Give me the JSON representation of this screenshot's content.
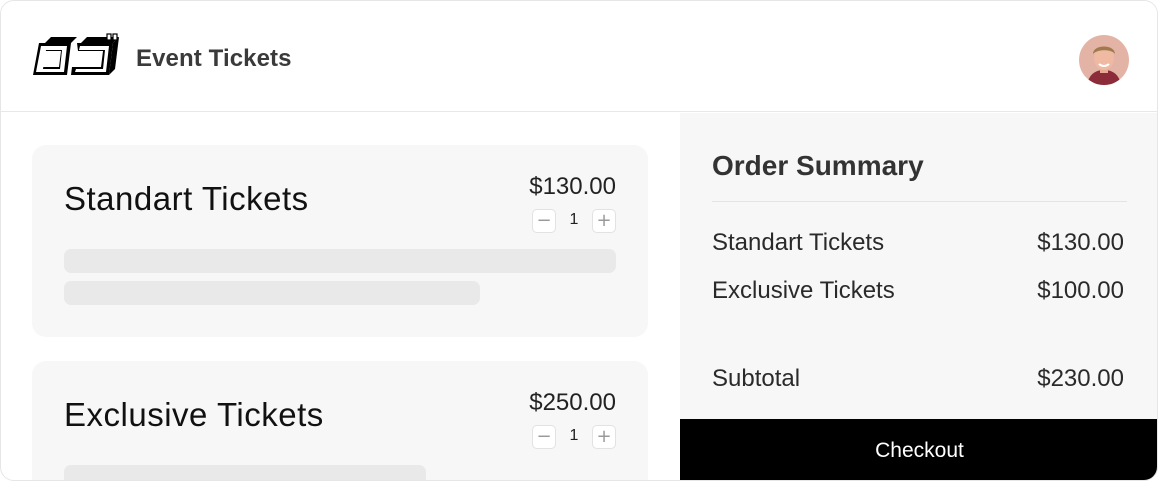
{
  "header": {
    "logo": "oj-logo",
    "title": "Event Tickets",
    "avatar": "user-avatar"
  },
  "tickets": [
    {
      "name": "Standart Tickets",
      "price": "$130.00",
      "quantity": "1",
      "minus_icon": "minus-icon",
      "plus_icon": "plus-icon"
    },
    {
      "name": "Exclusive Tickets",
      "price": "$250.00",
      "quantity": "1",
      "minus_icon": "minus-icon",
      "plus_icon": "plus-icon"
    }
  ],
  "summary": {
    "title": "Order Summary",
    "items": [
      {
        "label": "Standart Tickets",
        "amount": "$130.00"
      },
      {
        "label": "Exclusive Tickets",
        "amount": "$100.00"
      }
    ],
    "subtotal_label": "Subtotal",
    "subtotal_amount": "$230.00",
    "checkout_label": "Checkout"
  },
  "colors": {
    "accent": "#000000",
    "card_bg": "#f7f7f7",
    "skeleton": "#e9e9e9"
  }
}
